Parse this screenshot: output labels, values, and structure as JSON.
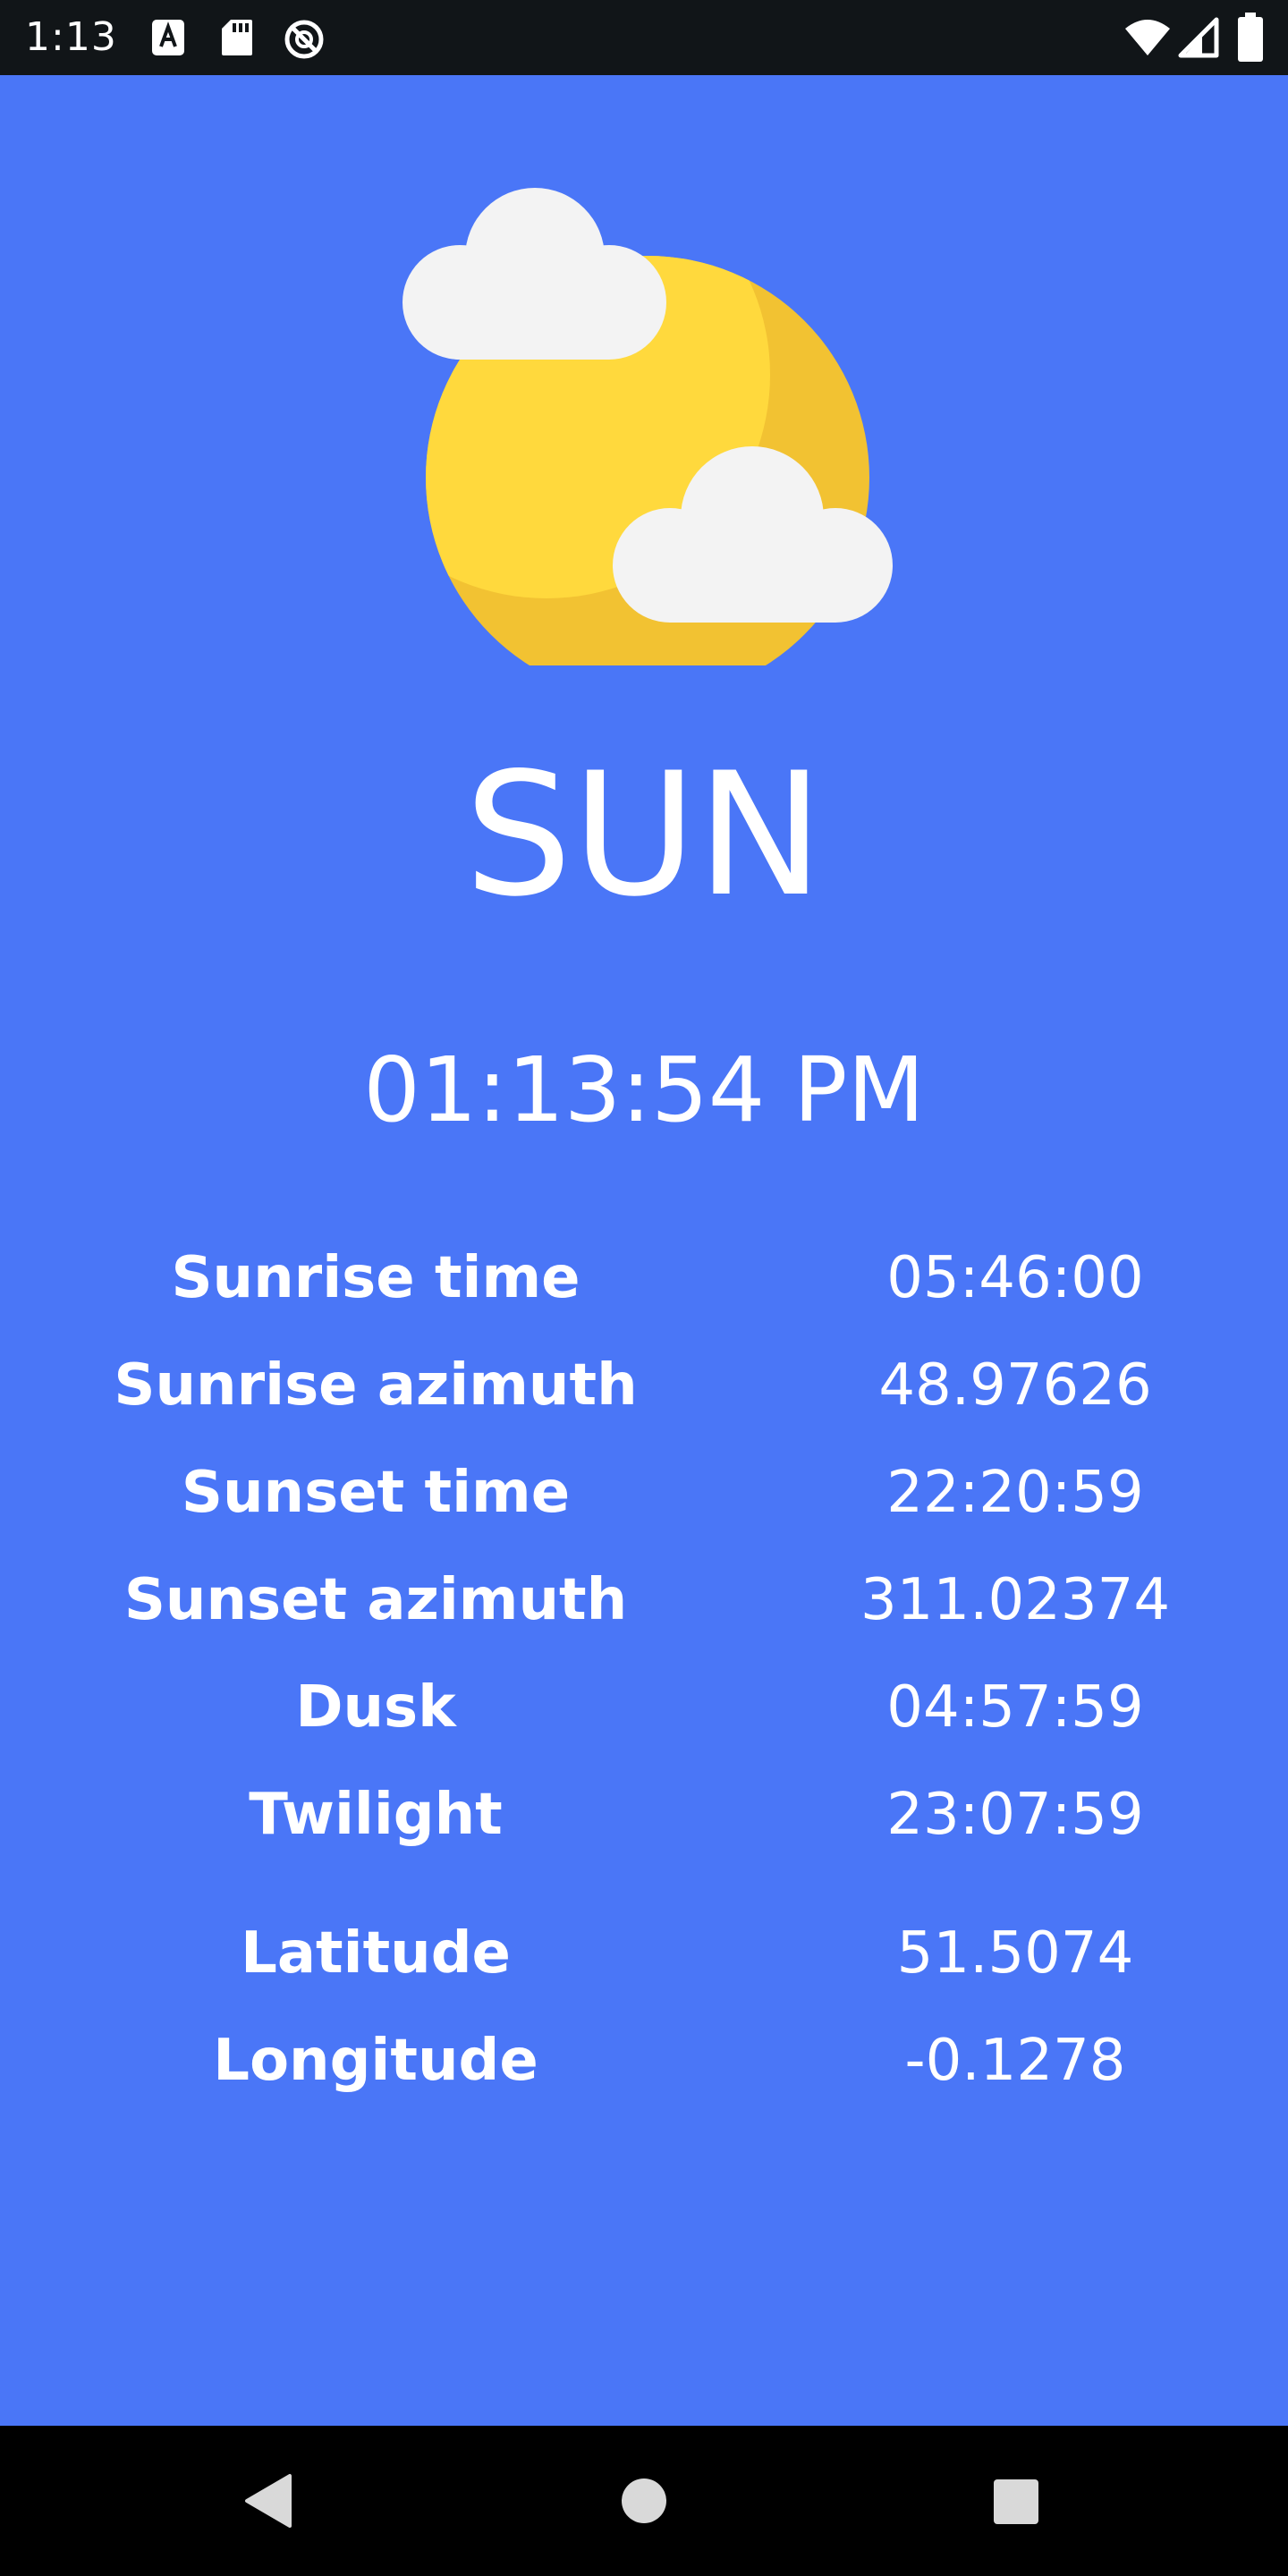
{
  "status_bar": {
    "time": "1:13",
    "left_icons": [
      "font-icon",
      "sd-card-icon",
      "do-not-disturb-icon"
    ],
    "right_icons": [
      "wifi-icon",
      "cell-signal-icon",
      "battery-icon"
    ]
  },
  "hero": {
    "icon": "sun-with-clouds-icon",
    "colors": {
      "sun": "#FFD93D",
      "sun_shadow": "#F2C232",
      "cloud": "#F3F3F3"
    }
  },
  "title": "SUN",
  "current_time": "01:13:54 PM",
  "info": [
    {
      "label": "Sunrise time",
      "value": "05:46:00"
    },
    {
      "label": "Sunrise azimuth",
      "value": "48.97626"
    },
    {
      "label": "Sunset time",
      "value": "22:20:59"
    },
    {
      "label": "Sunset azimuth",
      "value": "311.02374"
    },
    {
      "label": "Dusk",
      "value": "04:57:59"
    },
    {
      "label": "Twilight",
      "value": "23:07:59"
    },
    {
      "label": "Latitude",
      "value": "51.5074"
    },
    {
      "label": "Longitude",
      "value": "-0.1278"
    }
  ],
  "nav_bar": {
    "buttons": [
      "back-icon",
      "home-icon",
      "recents-icon"
    ]
  },
  "colors": {
    "background": "#4A76F7",
    "text": "#FFFFFF",
    "status_bar": "#111518",
    "nav_bar": "#000000"
  }
}
